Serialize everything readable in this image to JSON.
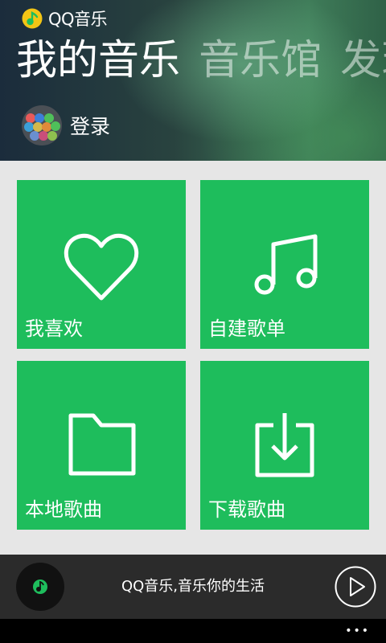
{
  "app": {
    "name": "QQ音乐"
  },
  "pivots": [
    {
      "label": "我的音乐",
      "active": true
    },
    {
      "label": "音乐馆",
      "active": false
    },
    {
      "label": "发现",
      "active": false
    }
  ],
  "login": {
    "label": "登录"
  },
  "tiles": [
    {
      "label": "我喜欢",
      "icon": "heart-icon"
    },
    {
      "label": "自建歌单",
      "icon": "music-note-icon"
    },
    {
      "label": "本地歌曲",
      "icon": "folder-icon"
    },
    {
      "label": "下载歌曲",
      "icon": "download-icon"
    }
  ],
  "player": {
    "now_playing": "QQ音乐,音乐你的生活"
  },
  "appbar": {
    "more": "•••"
  },
  "colors": {
    "accent": "#1ebd5c",
    "player_bg": "#2b2b2b",
    "page_bg": "#e6e6e6"
  }
}
